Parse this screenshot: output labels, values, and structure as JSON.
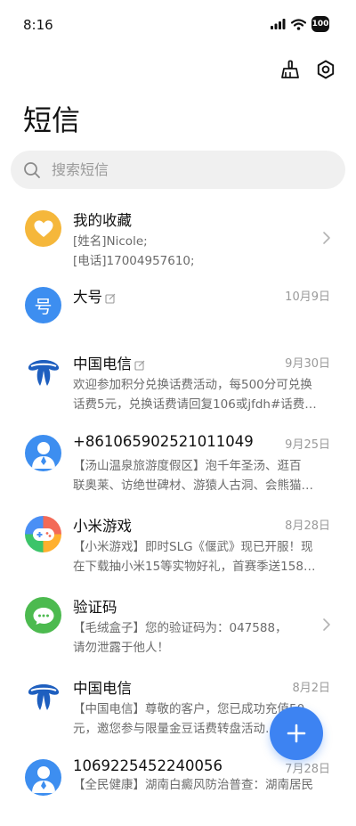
{
  "status": {
    "time": "8:16",
    "battery": "100"
  },
  "header": {
    "title": "短信"
  },
  "search": {
    "placeholder": "搜索短信"
  },
  "conversations": [
    {
      "name": "我的收藏",
      "date": "",
      "line1": "[姓名]Nicole;",
      "line2": "[电话]17004957610;",
      "avatar": "heart-icon",
      "avatar_color": "#f5b73b"
    },
    {
      "name": "大号",
      "date": "10月9日",
      "line1": "",
      "line2": "",
      "avatar": "hao-glyph-icon",
      "avatar_color": "#3d8ef0",
      "avatar_text": "号"
    },
    {
      "name": "中国电信",
      "date": "9月30日",
      "line1": "欢迎参加积分兑换话费活动，每500分可兑换",
      "line2": "话费5元，兑换话费请回复106或jfdh#话费…",
      "avatar": "china-telecom-logo",
      "avatar_color": "#1e5fbf"
    },
    {
      "name": "+8610659025210110​49",
      "date": "9月25日",
      "line1": "【汤山温泉旅游度假区】泡千年圣汤、逛百",
      "line2": "联奥莱、访绝世碑材、游猿人古洞、会熊猫…",
      "avatar": "person-icon",
      "avatar_color": "#3d8ef0"
    },
    {
      "name": "小米游戏",
      "date": "8月28日",
      "line1": "【小米游戏】即时SLG《偃武》现已开服！现",
      "line2": "在下载抽小米15等实物好礼，首赛季送158…",
      "avatar": "gamepad-icon",
      "avatar_color": "#f36a57"
    },
    {
      "name": "验证码",
      "date": "",
      "line1": "【毛绒盒子】您的验证码为：047588，",
      "line2": "请勿泄露于他人！",
      "avatar": "chat-bubble-icon",
      "avatar_color": "#4cba4f"
    },
    {
      "name": "中国电信",
      "date": "8月2日",
      "line1": "【中国电信】尊敬的客户，您已成功充值50",
      "line2": "元，邀您参与限量金豆话费转盘活动…",
      "avatar": "china-telecom-logo",
      "avatar_color": "#1e5fbf"
    },
    {
      "name": "1069225452240056",
      "date": "7月28日",
      "line1": "【全民健康】湖南白癜风防治普查：湖南居民",
      "line2": "",
      "avatar": "person-icon",
      "avatar_color": "#3d8ef0"
    }
  ]
}
